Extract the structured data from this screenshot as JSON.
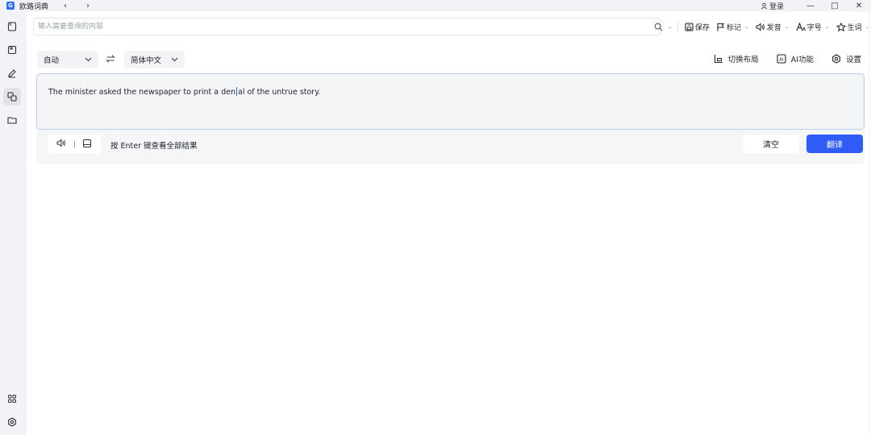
{
  "titlebar": {
    "app_name": "欧路词典",
    "logo_letter": "G",
    "login_label": "登录"
  },
  "search": {
    "placeholder": "输入需要查询的内容",
    "value": ""
  },
  "toolbar": {
    "save_label": "保存",
    "mark_label": "标记",
    "pronounce_label": "发音",
    "font_label": "字号",
    "vocab_label": "生词"
  },
  "translate": {
    "source_lang": "自动",
    "target_lang": "简体中文",
    "layout_label": "切换布局",
    "ai_label": "AI功能",
    "settings_label": "设置",
    "input_text_before": "The minister asked the newspaper to print a den",
    "input_text_after": "al of the untrue story.",
    "hint": "按 Enter 键查看全部结果",
    "clear_label": "清空",
    "translate_label": "翻译"
  },
  "colors": {
    "accent": "#2f5cf6",
    "editor_border": "#b9cdf3",
    "sidebar_bg": "#f2f3f6"
  },
  "icons": {
    "sidebar": [
      "dictionary-icon",
      "book-icon",
      "pen-icon",
      "translate-icon",
      "folder-icon",
      "apps-icon",
      "settings-icon"
    ]
  }
}
